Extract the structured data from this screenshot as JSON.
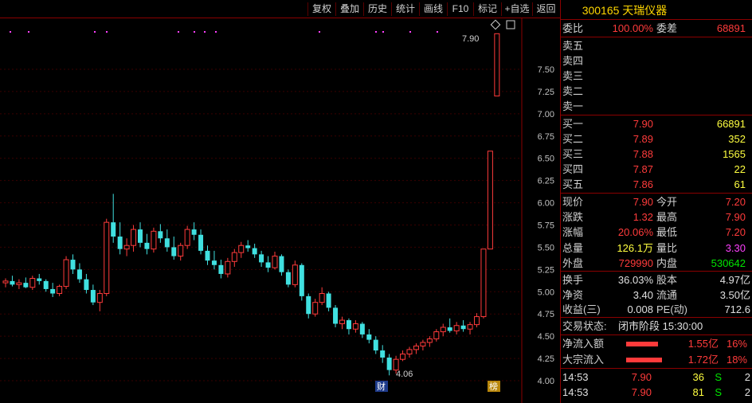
{
  "toolbar": {
    "buttons": [
      "复权",
      "叠加",
      "历史",
      "统计",
      "画线",
      "F10",
      "标记",
      "+自选",
      "返回"
    ]
  },
  "chart": {
    "price_ticks": [
      "7.50",
      "7.25",
      "7.00",
      "6.75",
      "6.50",
      "6.25",
      "6.00",
      "5.75",
      "5.50",
      "5.25",
      "5.00",
      "4.75",
      "4.50",
      "4.25",
      "4.00"
    ],
    "high_label": "7.90",
    "low_label": "4.06",
    "bottom_badge_cai": "财",
    "bottom_badge_bang": "榜",
    "colors": {
      "up": "#ff3b3b",
      "down": "#40e0e0",
      "grid": "#3a0000",
      "axis": "#8b0000",
      "marker": "#ff40ff"
    }
  },
  "chart_data": {
    "type": "candlestick",
    "candles": [
      [
        5.1,
        5.15,
        5.05,
        5.12
      ],
      [
        5.12,
        5.18,
        5.06,
        5.08
      ],
      [
        5.08,
        5.14,
        5.03,
        5.1
      ],
      [
        5.1,
        5.16,
        5.04,
        5.05
      ],
      [
        5.05,
        5.18,
        5.02,
        5.15
      ],
      [
        5.15,
        5.2,
        5.08,
        5.12
      ],
      [
        5.12,
        5.14,
        5.0,
        5.03
      ],
      [
        5.03,
        5.1,
        4.94,
        4.98
      ],
      [
        4.98,
        5.08,
        4.95,
        5.06
      ],
      [
        5.06,
        5.4,
        5.03,
        5.36
      ],
      [
        5.36,
        5.42,
        5.2,
        5.25
      ],
      [
        5.25,
        5.32,
        5.1,
        5.14
      ],
      [
        5.14,
        5.2,
        4.98,
        5.02
      ],
      [
        5.02,
        5.08,
        4.85,
        4.88
      ],
      [
        4.88,
        5.02,
        4.78,
        4.98
      ],
      [
        4.98,
        5.82,
        4.95,
        5.78
      ],
      [
        5.78,
        6.1,
        5.55,
        5.62
      ],
      [
        5.62,
        5.78,
        5.42,
        5.48
      ],
      [
        5.48,
        5.6,
        5.4,
        5.52
      ],
      [
        5.52,
        5.75,
        5.45,
        5.7
      ],
      [
        5.7,
        5.78,
        5.5,
        5.55
      ],
      [
        5.55,
        5.65,
        5.42,
        5.48
      ],
      [
        5.48,
        5.72,
        5.44,
        5.68
      ],
      [
        5.68,
        5.76,
        5.55,
        5.6
      ],
      [
        5.6,
        5.7,
        5.45,
        5.5
      ],
      [
        5.5,
        5.62,
        5.36,
        5.4
      ],
      [
        5.4,
        5.55,
        5.35,
        5.52
      ],
      [
        5.52,
        5.74,
        5.48,
        5.7
      ],
      [
        5.7,
        5.78,
        5.58,
        5.64
      ],
      [
        5.64,
        5.7,
        5.42,
        5.46
      ],
      [
        5.46,
        5.52,
        5.3,
        5.35
      ],
      [
        5.35,
        5.46,
        5.25,
        5.3
      ],
      [
        5.3,
        5.36,
        5.15,
        5.2
      ],
      [
        5.2,
        5.38,
        5.16,
        5.34
      ],
      [
        5.34,
        5.48,
        5.28,
        5.44
      ],
      [
        5.44,
        5.56,
        5.38,
        5.52
      ],
      [
        5.52,
        5.58,
        5.45,
        5.49
      ],
      [
        5.49,
        5.54,
        5.38,
        5.42
      ],
      [
        5.42,
        5.46,
        5.28,
        5.33
      ],
      [
        5.33,
        5.4,
        5.22,
        5.27
      ],
      [
        5.27,
        5.45,
        5.25,
        5.4
      ],
      [
        5.4,
        5.42,
        5.18,
        5.22
      ],
      [
        5.22,
        5.25,
        5.05,
        5.08
      ],
      [
        5.08,
        5.35,
        5.05,
        5.3
      ],
      [
        5.3,
        5.32,
        4.9,
        4.95
      ],
      [
        4.95,
        4.98,
        4.7,
        4.75
      ],
      [
        4.75,
        4.92,
        4.72,
        4.88
      ],
      [
        4.88,
        5.05,
        4.85,
        4.98
      ],
      [
        4.98,
        5.0,
        4.78,
        4.82
      ],
      [
        4.82,
        4.85,
        4.6,
        4.64
      ],
      [
        4.64,
        4.72,
        4.58,
        4.68
      ],
      [
        4.68,
        4.7,
        4.52,
        4.58
      ],
      [
        4.58,
        4.68,
        4.54,
        4.64
      ],
      [
        4.64,
        4.66,
        4.48,
        4.52
      ],
      [
        4.52,
        4.58,
        4.42,
        4.46
      ],
      [
        4.46,
        4.5,
        4.3,
        4.34
      ],
      [
        4.34,
        4.4,
        4.2,
        4.26
      ],
      [
        4.26,
        4.3,
        4.06,
        4.12
      ],
      [
        4.12,
        4.28,
        4.08,
        4.24
      ],
      [
        4.24,
        4.34,
        4.22,
        4.3
      ],
      [
        4.3,
        4.38,
        4.26,
        4.35
      ],
      [
        4.35,
        4.42,
        4.3,
        4.39
      ],
      [
        4.39,
        4.46,
        4.34,
        4.43
      ],
      [
        4.43,
        4.5,
        4.38,
        4.47
      ],
      [
        4.47,
        4.58,
        4.44,
        4.55
      ],
      [
        4.55,
        4.64,
        4.5,
        4.6
      ],
      [
        4.6,
        4.7,
        4.54,
        4.56
      ],
      [
        4.56,
        4.66,
        4.52,
        4.62
      ],
      [
        4.62,
        4.68,
        4.55,
        4.58
      ],
      [
        4.58,
        4.66,
        4.52,
        4.63
      ],
      [
        4.63,
        4.76,
        4.6,
        4.72
      ],
      [
        4.72,
        5.48,
        4.7,
        5.48
      ],
      [
        5.48,
        6.58,
        5.48,
        6.58
      ],
      [
        7.2,
        7.9,
        7.2,
        7.9
      ]
    ]
  },
  "quote": {
    "title": "300165 天瑞仪器",
    "weibi_label": "委比",
    "weibi": "100.00%",
    "weicha_label": "委差",
    "weicha": "68891",
    "sell": [
      {
        "label": "卖五"
      },
      {
        "label": "卖四"
      },
      {
        "label": "卖三"
      },
      {
        "label": "卖二"
      },
      {
        "label": "卖一"
      }
    ],
    "buy": [
      {
        "label": "买一",
        "price": "7.90",
        "vol": "66891"
      },
      {
        "label": "买二",
        "price": "7.89",
        "vol": "352"
      },
      {
        "label": "买三",
        "price": "7.88",
        "vol": "1565"
      },
      {
        "label": "买四",
        "price": "7.87",
        "vol": "22"
      },
      {
        "label": "买五",
        "price": "7.86",
        "vol": "61"
      }
    ],
    "stats": [
      {
        "l1": "现价",
        "v1": "7.90",
        "c1": "red",
        "l2": "今开",
        "v2": "7.20",
        "c2": "red"
      },
      {
        "l1": "涨跌",
        "v1": "1.32",
        "c1": "red",
        "l2": "最高",
        "v2": "7.90",
        "c2": "red"
      },
      {
        "l1": "涨幅",
        "v1": "20.06%",
        "c1": "red",
        "l2": "最低",
        "v2": "7.20",
        "c2": "red"
      },
      {
        "l1": "总量",
        "v1": "126.1万",
        "c1": "yel",
        "l2": "量比",
        "v2": "3.30",
        "c2": "mag"
      },
      {
        "l1": "外盘",
        "v1": "729990",
        "c1": "red",
        "l2": "内盘",
        "v2": "530642",
        "c2": "grn"
      }
    ],
    "fund": [
      {
        "l1": "换手",
        "v1": "36.03%",
        "l2": "股本",
        "v2": "4.97亿"
      },
      {
        "l1": "净资",
        "v1": "3.40",
        "l2": "流通",
        "v2": "3.50亿"
      },
      {
        "l1": "收益(三)",
        "v1": "0.008",
        "l2": "PE(动)",
        "v2": "712.6"
      }
    ],
    "status_label": "交易状态:",
    "status_value": "闭市阶段 15:30:00",
    "flows": [
      {
        "label": "净流入额",
        "amount": "1.55亿",
        "pct": "16%",
        "ratio": 0.16
      },
      {
        "label": "大宗流入",
        "amount": "1.72亿",
        "pct": "18%",
        "ratio": 0.18
      }
    ],
    "ticks": [
      {
        "time": "14:53",
        "price": "7.90",
        "vol": "36",
        "side": "S",
        "n": "2"
      },
      {
        "time": "14:53",
        "price": "7.90",
        "vol": "81",
        "side": "S",
        "n": "2"
      }
    ]
  }
}
